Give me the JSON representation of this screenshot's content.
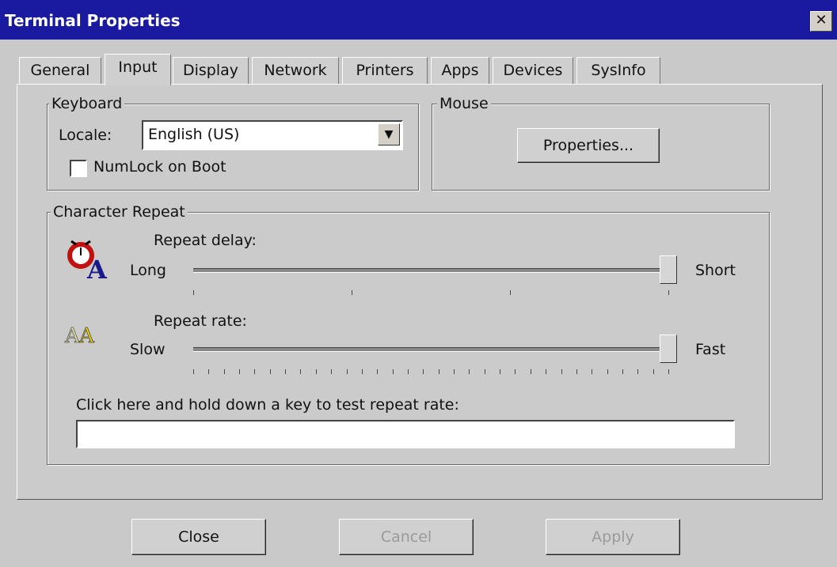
{
  "window": {
    "title": "Terminal Properties",
    "close_glyph": "✕"
  },
  "tabs": [
    {
      "label": "General"
    },
    {
      "label": "Input",
      "active": true
    },
    {
      "label": "Display"
    },
    {
      "label": "Network"
    },
    {
      "label": "Printers"
    },
    {
      "label": "Apps"
    },
    {
      "label": "Devices"
    },
    {
      "label": "SysInfo"
    }
  ],
  "keyboard": {
    "legend": "Keyboard",
    "locale_label": "Locale:",
    "locale_value": "English (US)",
    "numlock_label": "NumLock on Boot",
    "numlock_checked": false
  },
  "mouse": {
    "legend": "Mouse",
    "properties_label": "Properties..."
  },
  "repeat": {
    "legend": "Character Repeat",
    "delay": {
      "label": "Repeat delay:",
      "min_label": "Long",
      "max_label": "Short",
      "value_fraction": 1.0,
      "ticks": 4
    },
    "rate": {
      "label": "Repeat rate:",
      "min_label": "Slow",
      "max_label": "Fast",
      "value_fraction": 1.0,
      "ticks": 32
    },
    "test_label": "Click here and hold down a key to test repeat rate:",
    "test_value": ""
  },
  "footer": {
    "close_label": "Close",
    "cancel_label": "Cancel",
    "apply_label": "Apply"
  },
  "icons": {
    "delay_icon": "alarm-clock-letter-a-icon",
    "rate_icon": "double-letter-a-icon"
  }
}
